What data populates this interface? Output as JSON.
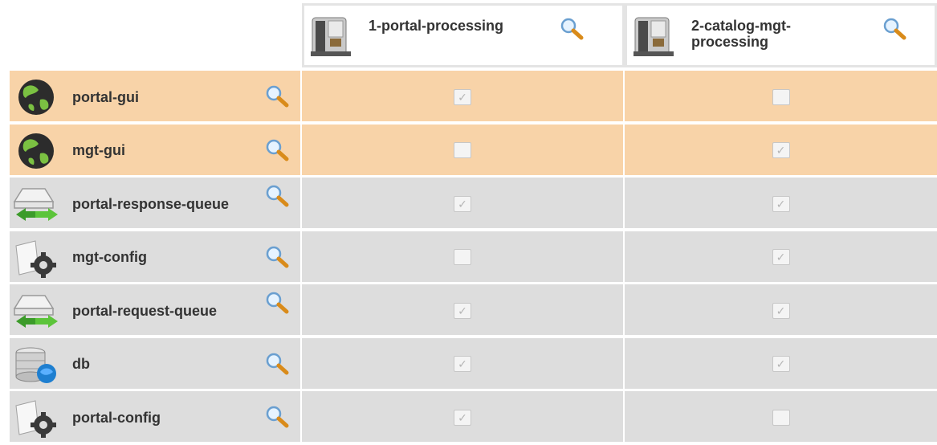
{
  "columns": [
    {
      "title": "1-portal-processing",
      "icon": "coffee-machine-icon",
      "has_search": true
    },
    {
      "title": "2-catalog-mgt-processing",
      "icon": "coffee-machine-icon",
      "has_search": true
    }
  ],
  "rows": [
    {
      "name": "portal-gui",
      "icon": "globe-icon",
      "style": "orange",
      "checks": [
        true,
        false
      ]
    },
    {
      "name": "mgt-gui",
      "icon": "globe-icon",
      "style": "orange",
      "checks": [
        false,
        true
      ]
    },
    {
      "name": "portal-response-queue",
      "icon": "queue-arrows-icon",
      "style": "grey",
      "checks": [
        true,
        true
      ]
    },
    {
      "name": "mgt-config",
      "icon": "config-gear-icon",
      "style": "grey",
      "checks": [
        false,
        true
      ]
    },
    {
      "name": "portal-request-queue",
      "icon": "queue-arrows-icon",
      "style": "grey",
      "checks": [
        true,
        true
      ]
    },
    {
      "name": "db",
      "icon": "database-icon",
      "style": "grey",
      "checks": [
        true,
        true
      ]
    },
    {
      "name": "portal-config",
      "icon": "config-gear-icon",
      "style": "grey",
      "checks": [
        true,
        false
      ]
    }
  ],
  "check_mark": "✓",
  "colors": {
    "orange_row": "#f8d3a8",
    "grey_row": "#dddddd",
    "text": "#333333"
  }
}
